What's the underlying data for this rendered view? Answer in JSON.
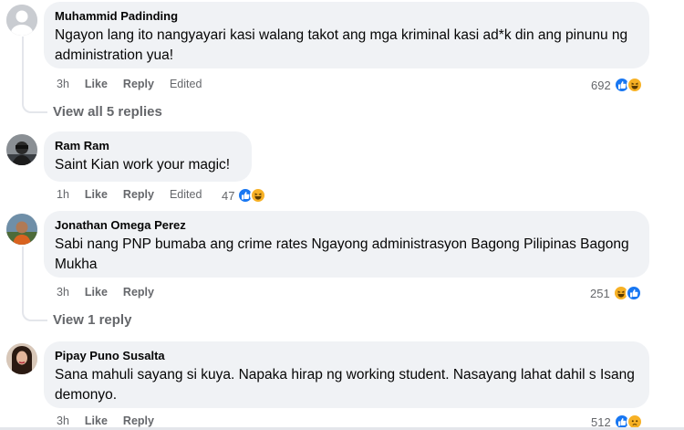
{
  "comments": [
    {
      "author": "Muhammid Padinding",
      "text": "Ngayon lang ito nangyayari kasi walang takot ang mga kriminal kasi ad*k din ang pinunu ng administration yua!",
      "time": "3h",
      "like_label": "Like",
      "reply_label": "Reply",
      "edited_label": "Edited",
      "reaction_count": "692",
      "reactions": [
        "like-icon",
        "haha-icon"
      ],
      "replies_label": "View all 5 replies"
    },
    {
      "author": "Ram Ram",
      "text": "Saint Kian work your magic!",
      "time": "1h",
      "like_label": "Like",
      "reply_label": "Reply",
      "edited_label": "Edited",
      "reaction_count": "47",
      "reactions": [
        "like-icon",
        "haha-icon"
      ]
    },
    {
      "author": "Jonathan Omega Perez",
      "text": "Sabi nang PNP bumaba ang crime rates Ngayong administrasyon Bagong Pilipinas Bagong Mukha",
      "time": "3h",
      "like_label": "Like",
      "reply_label": "Reply",
      "reaction_count": "251",
      "reactions": [
        "haha-icon",
        "like-icon"
      ],
      "replies_label": "View 1 reply"
    },
    {
      "author": "Pipay Puno Susalta",
      "text": "Sana mahuli sayang si kuya. Napaka hirap ng working student. Nasayang lahat dahil s Isang demonyo.",
      "time": "3h",
      "like_label": "Like",
      "reply_label": "Reply",
      "reaction_count": "512",
      "reactions": [
        "like-icon",
        "sad-icon"
      ]
    }
  ],
  "colors": {
    "bubble": "#f0f2f5",
    "meta": "#65676b",
    "like_blue": "#1877f2",
    "emoji_yellow": "#f7b125"
  }
}
